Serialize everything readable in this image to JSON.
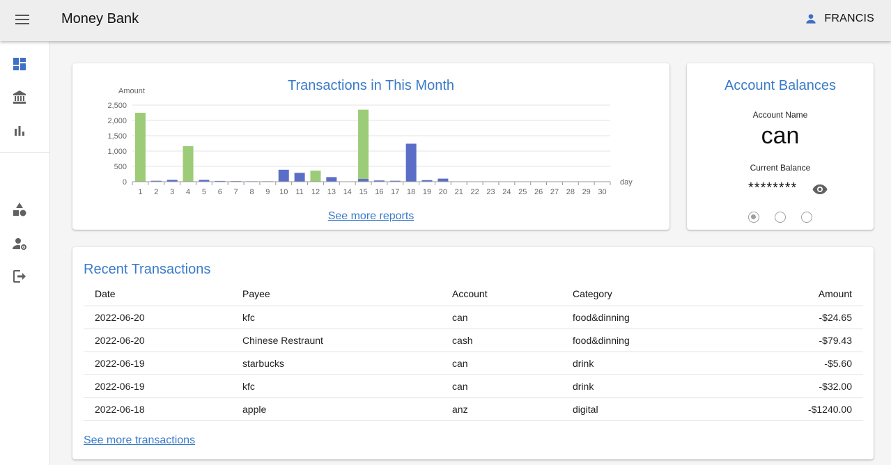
{
  "app": {
    "title": "Money Bank",
    "user": "FRANCIS"
  },
  "sidebar": {
    "items": [
      {
        "icon": "dashboard-icon"
      },
      {
        "icon": "bank-icon"
      },
      {
        "icon": "bar-chart-icon"
      },
      {
        "icon": "category-icon"
      },
      {
        "icon": "manage-accounts-icon"
      },
      {
        "icon": "logout-icon"
      }
    ]
  },
  "report": {
    "title": "Transactions in This Month",
    "see_more": "See more reports"
  },
  "chart_data": {
    "type": "bar",
    "title": "Transactions in This Month",
    "xlabel": "day",
    "ylabel": "Amount",
    "ylim": [
      0,
      2500
    ],
    "yticks": [
      "0",
      "500",
      "1,000",
      "1,500",
      "2,000",
      "2,500"
    ],
    "categories": [
      "1",
      "2",
      "3",
      "4",
      "5",
      "6",
      "7",
      "8",
      "9",
      "10",
      "11",
      "12",
      "13",
      "14",
      "15",
      "16",
      "17",
      "18",
      "19",
      "20",
      "21",
      "22",
      "23",
      "24",
      "25",
      "26",
      "27",
      "28",
      "29",
      "30"
    ],
    "series": [
      {
        "color": "#9ccc78",
        "values": [
          2250,
          0,
          0,
          1160,
          0,
          0,
          0,
          0,
          0,
          0,
          0,
          360,
          0,
          0,
          2350,
          0,
          0,
          0,
          0,
          0,
          0,
          0,
          0,
          0,
          0,
          0,
          0,
          0,
          0,
          0
        ]
      },
      {
        "color": "#5b6ec7",
        "values": [
          0,
          30,
          60,
          0,
          60,
          25,
          20,
          15,
          15,
          390,
          290,
          0,
          150,
          0,
          90,
          40,
          30,
          1240,
          50,
          100,
          0,
          0,
          0,
          0,
          0,
          0,
          0,
          0,
          0,
          0
        ]
      }
    ],
    "grid": true
  },
  "balance": {
    "title": "Account Balances",
    "name_label": "Account Name",
    "name": "can",
    "current_label": "Current Balance",
    "value": "********",
    "pages": 3,
    "active_page": 0
  },
  "recent": {
    "title": "Recent Transactions",
    "columns": {
      "date": "Date",
      "payee": "Payee",
      "account": "Account",
      "category": "Category",
      "amount": "Amount"
    },
    "rows": [
      {
        "date": "2022-06-20",
        "payee": "kfc",
        "account": "can",
        "category": "food&dinning",
        "amount": "-$24.65"
      },
      {
        "date": "2022-06-20",
        "payee": "Chinese Restraunt",
        "account": "cash",
        "category": "food&dinning",
        "amount": "-$79.43"
      },
      {
        "date": "2022-06-19",
        "payee": "starbucks",
        "account": "can",
        "category": "drink",
        "amount": "-$5.60"
      },
      {
        "date": "2022-06-19",
        "payee": "kfc",
        "account": "can",
        "category": "drink",
        "amount": "-$32.00"
      },
      {
        "date": "2022-06-18",
        "payee": "apple",
        "account": "anz",
        "category": "digital",
        "amount": "-$1240.00"
      }
    ],
    "see_more": "See more transactions"
  },
  "colors": {
    "accent": "#3a7bc8",
    "nav_active": "#3f6fc6",
    "nav_icon": "#616161"
  }
}
